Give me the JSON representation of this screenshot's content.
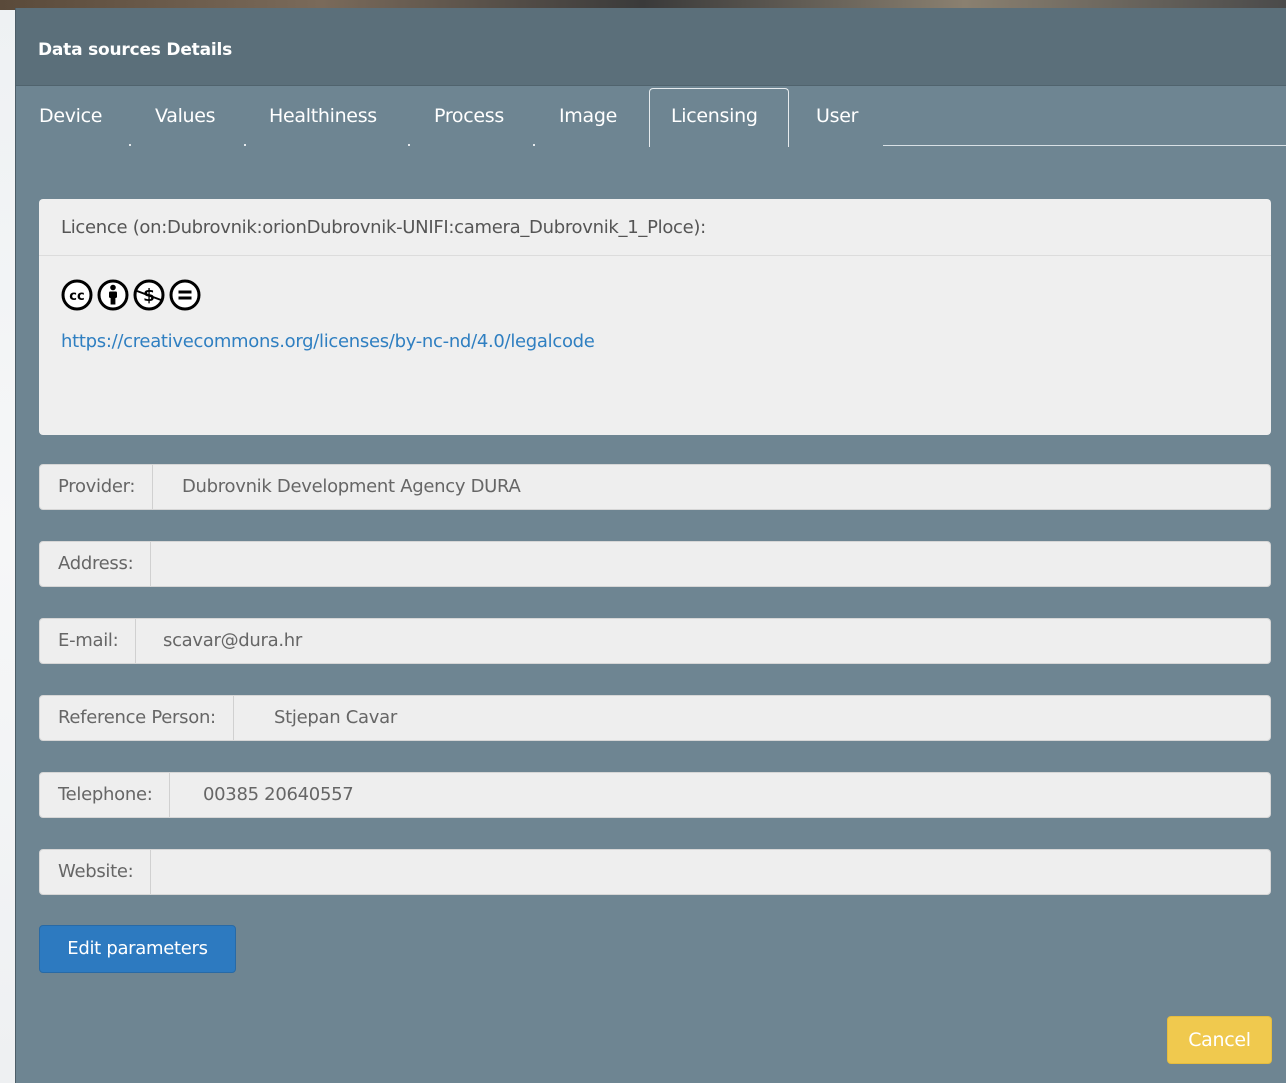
{
  "modal": {
    "title": "Data sources Details"
  },
  "tabs": [
    {
      "label": "Device"
    },
    {
      "label": "Values"
    },
    {
      "label": "Healthiness"
    },
    {
      "label": "Process"
    },
    {
      "label": "Image"
    },
    {
      "label": "Licensing",
      "active": true
    },
    {
      "label": "User"
    }
  ],
  "licence": {
    "title": "Licence (on:Dubrovnik:orionDubrovnik-UNIFI:camera_Dubrovnik_1_Ploce):",
    "badge_icons": [
      "cc-icon",
      "by-attribution-icon",
      "nc-noncommercial-icon",
      "nd-noderivatives-icon"
    ],
    "badge_letters": {
      "cc": "cc",
      "nc": "$",
      "nd": "="
    },
    "link": "https://creativecommons.org/licenses/by-nc-nd/4.0/legalcode"
  },
  "fields": {
    "provider": {
      "label": "Provider:",
      "value": "Dubrovnik Development Agency DURA"
    },
    "address": {
      "label": "Address:",
      "value": ""
    },
    "email": {
      "label": "E-mail:",
      "value": "scavar@dura.hr"
    },
    "reference_person": {
      "label": "Reference Person:",
      "value": "Stjepan Cavar"
    },
    "telephone": {
      "label": "Telephone:",
      "value": "00385 20640557"
    },
    "website": {
      "label": "Website:",
      "value": ""
    }
  },
  "buttons": {
    "edit_label": "Edit parameters",
    "cancel_label": "Cancel"
  },
  "colors": {
    "modal_bg": "#6e8592",
    "header_bg": "#5b6f7a",
    "link": "#2f7fc1",
    "primary_button": "#2d7ac0",
    "cancel_button": "#f0c94e"
  }
}
